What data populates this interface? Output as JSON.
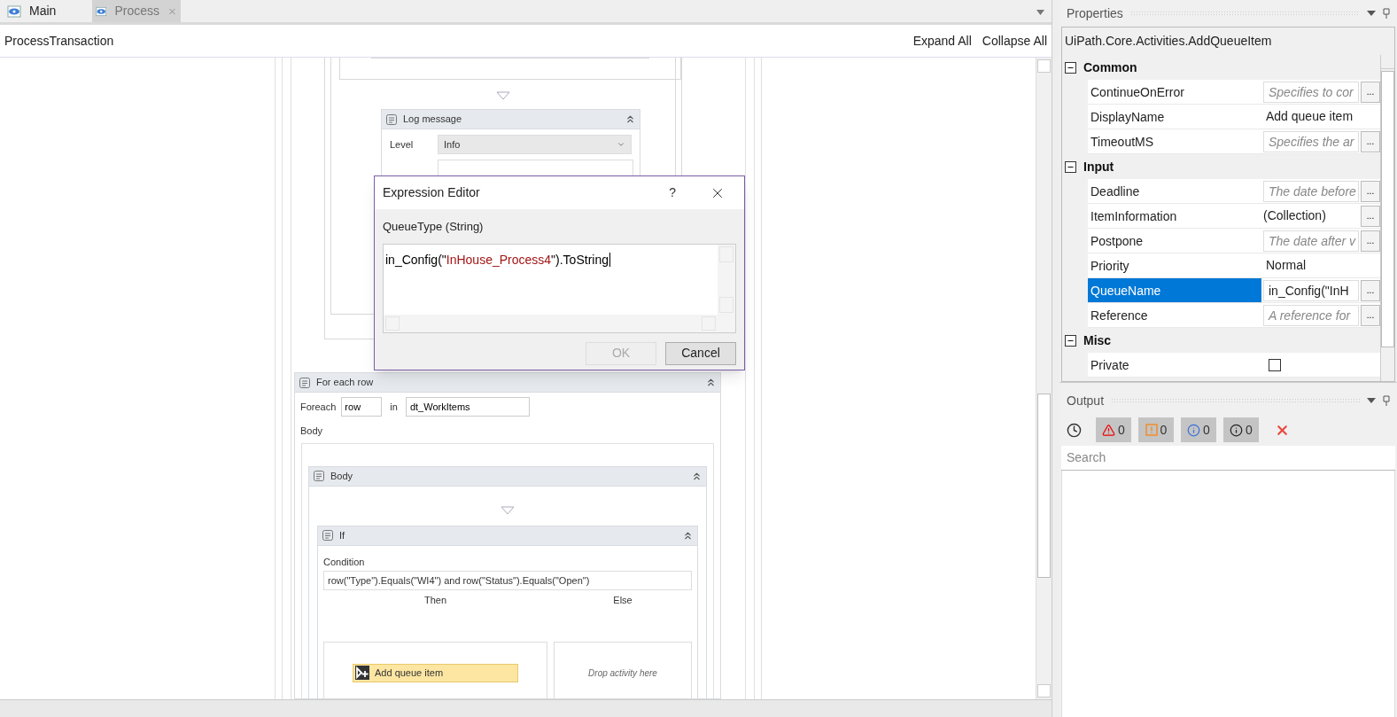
{
  "tabs": [
    {
      "label": "Main",
      "selected": true,
      "closable": false
    },
    {
      "label": "Process",
      "selected": false,
      "closable": true
    }
  ],
  "designer": {
    "breadcrumb": "ProcessTransaction",
    "actions": [
      "Expand All",
      "Collapse All"
    ],
    "log_message": {
      "title": "Log message",
      "level_label": "Level",
      "level_value": "Info"
    },
    "for_each": {
      "title": "For each row",
      "foreach_label": "Foreach",
      "item_var": "row",
      "in_label": "in",
      "collection": "dt_WorkItems",
      "body_label": "Body",
      "body": {
        "title": "Body",
        "if": {
          "title": "If",
          "condition_label": "Condition",
          "condition": "row(\"Type\").Equals(\"WI4\") and row(\"Status\").Equals(\"Open\")",
          "then_label": "Then",
          "else_label": "Else",
          "then_activity": "Add queue item",
          "else_placeholder": "Drop activity here"
        }
      }
    }
  },
  "dialog": {
    "title": "Expression Editor",
    "help": "?",
    "property_label": "QueueType (String)",
    "expression": [
      {
        "text": "in_Config(\"",
        "kind": "plain"
      },
      {
        "text": "InHouse_Process4",
        "kind": "string"
      },
      {
        "text": "\").ToString",
        "kind": "plain"
      }
    ],
    "buttons": [
      {
        "label": "OK",
        "disabled": true
      },
      {
        "label": "Cancel",
        "disabled": false
      }
    ]
  },
  "properties": {
    "title": "Properties",
    "type_name": "UiPath.Core.Activities.AddQueueItem",
    "categories": [
      {
        "name": "Common",
        "expanded": true,
        "rows": [
          {
            "name": "ContinueOnError",
            "kind": "placeholder",
            "placeholder": "Specifies to cor",
            "button": "...",
            "selected": false
          },
          {
            "name": "DisplayName",
            "kind": "text",
            "value": "Add queue item",
            "selected": false
          },
          {
            "name": "TimeoutMS",
            "kind": "placeholder",
            "placeholder": "Specifies the ar",
            "button": "...",
            "selected": false
          }
        ]
      },
      {
        "name": "Input",
        "expanded": true,
        "rows": [
          {
            "name": "Deadline",
            "kind": "placeholder",
            "placeholder": "The date before",
            "button": "...",
            "selected": false
          },
          {
            "name": "ItemInformation",
            "kind": "collection",
            "value": "(Collection)",
            "button": "...",
            "selected": false
          },
          {
            "name": "Postpone",
            "kind": "placeholder",
            "placeholder": "The date after v",
            "button": "...",
            "selected": false
          },
          {
            "name": "Priority",
            "kind": "text",
            "value": "Normal",
            "selected": false
          },
          {
            "name": "QueueName",
            "kind": "expression",
            "value": "in_Config(\"InH",
            "button": "...",
            "selected": true
          },
          {
            "name": "Reference",
            "kind": "placeholder",
            "placeholder": "A reference for",
            "button": "...",
            "selected": false
          }
        ]
      },
      {
        "name": "Misc",
        "expanded": true,
        "rows": [
          {
            "name": "Private",
            "kind": "checkbox",
            "checked": false,
            "selected": false
          }
        ]
      }
    ]
  },
  "output": {
    "title": "Output",
    "filters": [
      {
        "kind": "error",
        "count": "0"
      },
      {
        "kind": "warning",
        "count": "0"
      },
      {
        "kind": "info",
        "count": "0"
      },
      {
        "kind": "trace",
        "count": "0"
      }
    ],
    "search_placeholder": "Search"
  }
}
